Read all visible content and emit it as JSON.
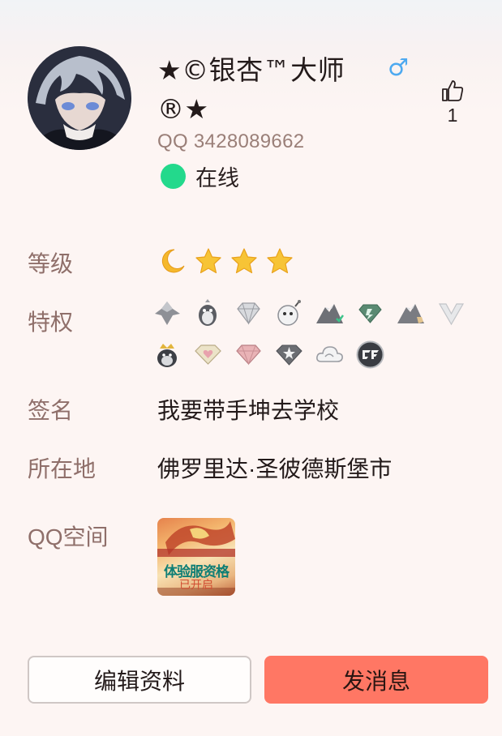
{
  "profile": {
    "nickname_line1": "★©银杏™大师",
    "nickname_line2": "®★",
    "gender_symbol": "♂",
    "gender_icon": "male-icon",
    "likes": "1",
    "qq_number": "QQ 3428089662",
    "status": "在线",
    "status_color": "#23d98c"
  },
  "rows": {
    "level_label": "等级",
    "level_icons": [
      "moon-icon",
      "star-icon",
      "star-icon",
      "star-icon"
    ],
    "privilege_label": "特权",
    "privilege_icons_row1": [
      "svip-crown-wing-icon",
      "penguin-badge-icon",
      "diamond-icon",
      "bomb-face-icon",
      "mountain-vip-icon",
      "green-diamond-icon",
      "mountain-gold-icon",
      "v-shield-icon"
    ],
    "privilege_icons_row2": [
      "crown-penguin-icon",
      "heart-diamond-icon",
      "pink-diamond-icon",
      "star-diamond-icon",
      "cloud-icon",
      "cf-game-icon"
    ],
    "signature_label": "签名",
    "signature": "我要带手坤去学校",
    "location_label": "所在地",
    "location": "佛罗里达·圣彼德斯堡市",
    "qzone_label": "QQ空间",
    "qzone_thumb_title": "体验服资格",
    "qzone_thumb_sub": "已开启"
  },
  "actions": {
    "edit_label": "编辑资料",
    "message_label": "发消息"
  },
  "colors": {
    "label": "#8f6f6a",
    "accent_button": "#ff7764",
    "gender_blue": "#4da9f0",
    "star_gold": "#f5b82c"
  }
}
